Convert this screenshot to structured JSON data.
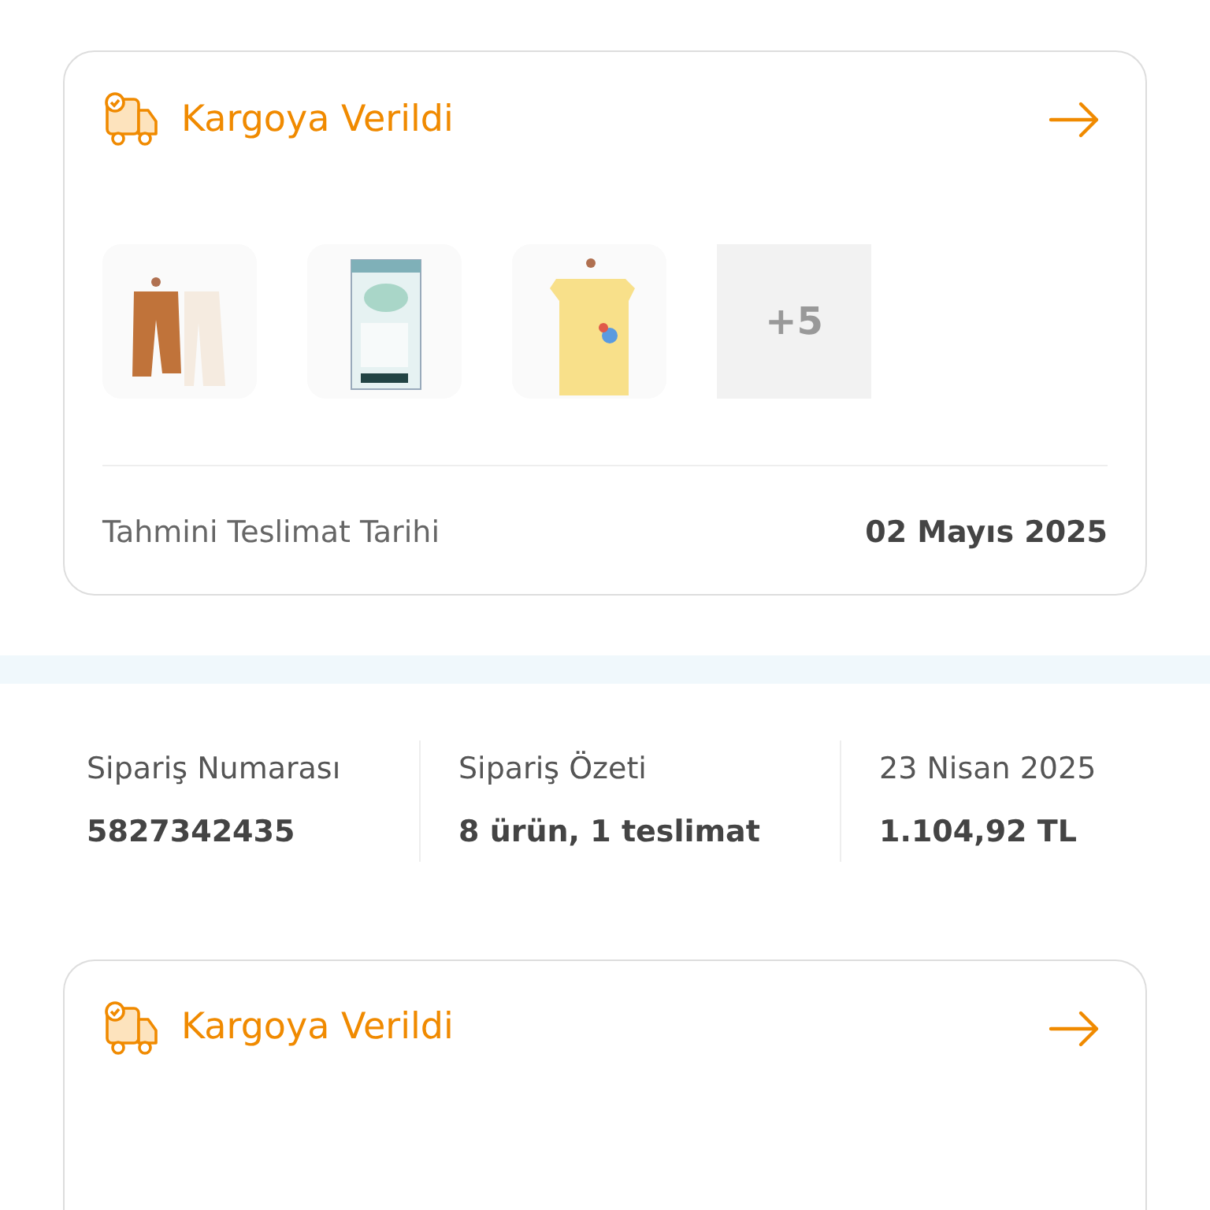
{
  "shipments": [
    {
      "status": "Kargoya Verildi",
      "more": "+5",
      "delivery_label": "Tahmini Teslimat Tarihi",
      "delivery_date": "02 Mayıs 2025"
    }
  ],
  "order": {
    "number_label": "Sipariş Numarası",
    "number": "5827342435",
    "summary_label": "Sipariş Özeti",
    "summary": "8 ürün, 1 teslimat",
    "date": "23 Nisan 2025",
    "total": "1.104,92 TL"
  },
  "next_shipment": {
    "status": "Kargoya Verildi"
  }
}
